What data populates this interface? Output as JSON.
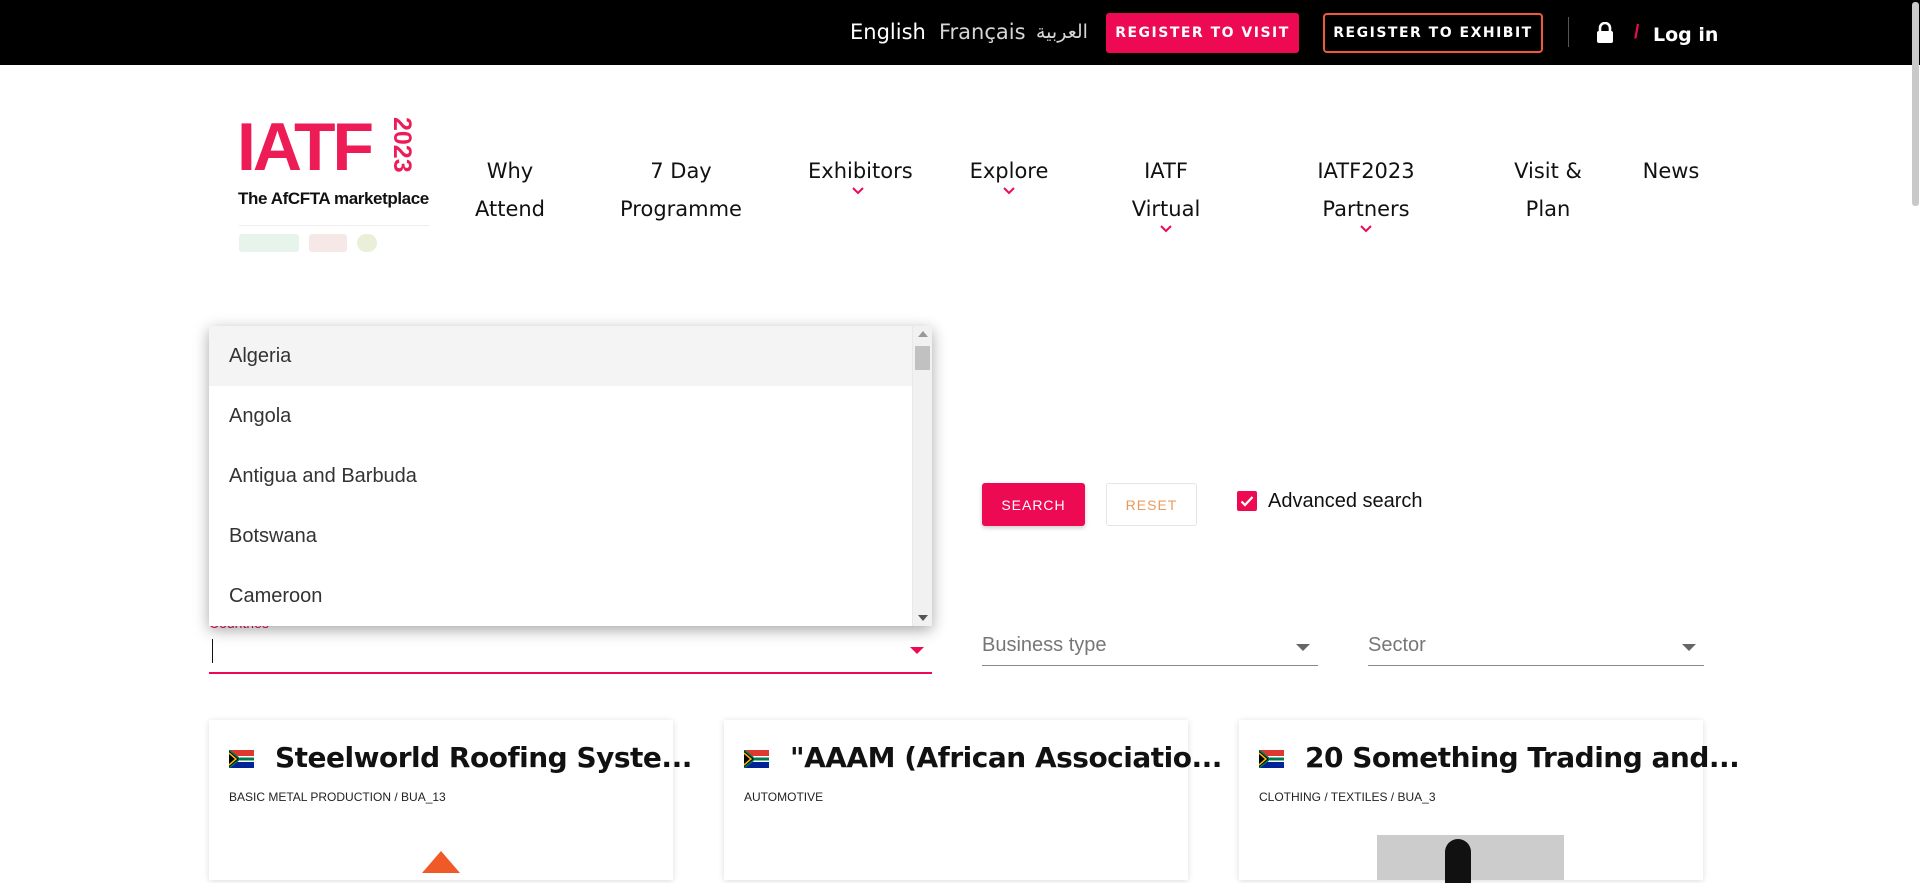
{
  "topbar": {
    "languages": [
      "English",
      "Français",
      "العربية"
    ],
    "register_visit": "REGISTER TO VISIT",
    "register_exhibit": "REGISTER TO EXHIBIT",
    "slash": "/",
    "login": "Log in"
  },
  "logo": {
    "name": "IATF",
    "year": "2023",
    "tagline": "The AfCFTA marketplace"
  },
  "nav": [
    {
      "line1": "Why",
      "line2": "Attend"
    },
    {
      "line1": "7 Day",
      "line2": "Programme"
    },
    {
      "line1": "Exhibitors",
      "dropdown": true
    },
    {
      "line1": "Explore",
      "dropdown": true
    },
    {
      "line1": "IATF Virtual",
      "dropdown": true
    },
    {
      "line1": "IATF2023 Partners",
      "dropdown": true
    },
    {
      "line1": "Visit &",
      "line2": "Plan"
    },
    {
      "line1": "News"
    }
  ],
  "filters": {
    "search": "SEARCH",
    "reset": "RESET",
    "advanced_search": "Advanced search",
    "advanced_checked": true,
    "countries_label": "Countries",
    "countries_value": "",
    "business_type": "Business type",
    "sector": "Sector"
  },
  "countries_dropdown": {
    "options": [
      "Algeria",
      "Angola",
      "Antigua and Barbuda",
      "Botswana",
      "Cameroon"
    ],
    "highlighted": "Algeria"
  },
  "cards": [
    {
      "title": "Steelworld Roofing Syste...",
      "subtitle": "BASIC METAL PRODUCTION / BUA_13",
      "country": "South Africa"
    },
    {
      "title": "\"AAAM (African Associatio...",
      "subtitle": "AUTOMOTIVE",
      "country": "South Africa"
    },
    {
      "title": "20 Something Trading and...",
      "subtitle": "CLOTHING / TEXTILES / BUA_3",
      "country": "South Africa"
    }
  ],
  "colors": {
    "accent": "#ed0a52",
    "exhibit_border": "#f05a3a",
    "topbar_bg": "#000000"
  }
}
